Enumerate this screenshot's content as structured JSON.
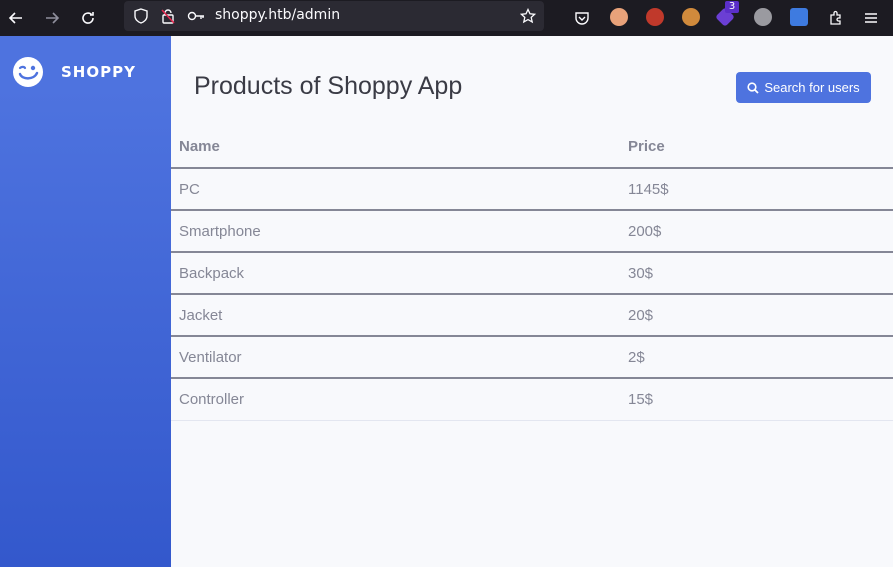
{
  "browser": {
    "url": "shoppy.htb/admin",
    "extension_badge": "3"
  },
  "sidebar": {
    "brand": "SHOPPY"
  },
  "main": {
    "title": "Products of Shoppy App",
    "search_button": "Search for users",
    "table": {
      "headers": [
        "Name",
        "Price"
      ],
      "rows": [
        [
          "PC",
          "1145$"
        ],
        [
          "Smartphone",
          "200$"
        ],
        [
          "Backpack",
          "30$"
        ],
        [
          "Jacket",
          "20$"
        ],
        [
          "Ventilator",
          "2$"
        ],
        [
          "Controller",
          "15$"
        ]
      ]
    }
  },
  "colors": {
    "accent": "#4e73df",
    "toolbar": "#1c1b22",
    "text_muted": "#858796"
  }
}
